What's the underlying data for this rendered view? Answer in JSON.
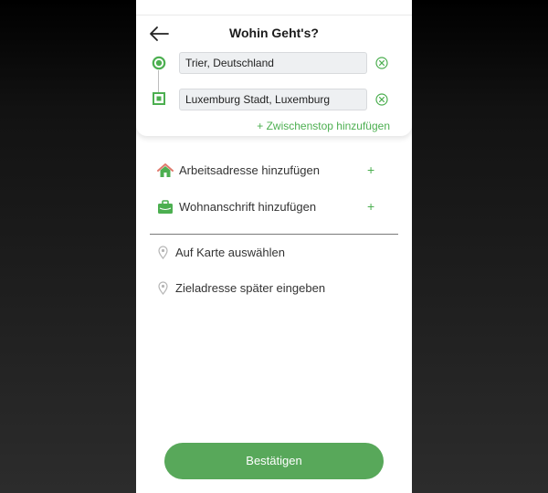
{
  "header": {
    "title": "Wohin Geht's?"
  },
  "route": {
    "origin": "Trier, Deutschland",
    "destination": "Luxemburg Stadt, Luxemburg",
    "add_stop_label": "+ Zwischenstop hinzufügen"
  },
  "saved_places": [
    {
      "label": "Arbeitsadresse hinzufügen",
      "icon": "house-icon",
      "action": "+"
    },
    {
      "label": "Wohnanschrift hinzufügen",
      "icon": "briefcase-icon",
      "action": "+"
    }
  ],
  "options": [
    {
      "label": "Auf Karte auswählen",
      "icon": "map-pin-icon"
    },
    {
      "label": "Zieladresse später eingeben",
      "icon": "map-pin-icon"
    }
  ],
  "confirm_label": "Bestätigen",
  "colors": {
    "accent": "#4caf50",
    "button": "#58a85a",
    "field_bg": "#eef0f2"
  }
}
